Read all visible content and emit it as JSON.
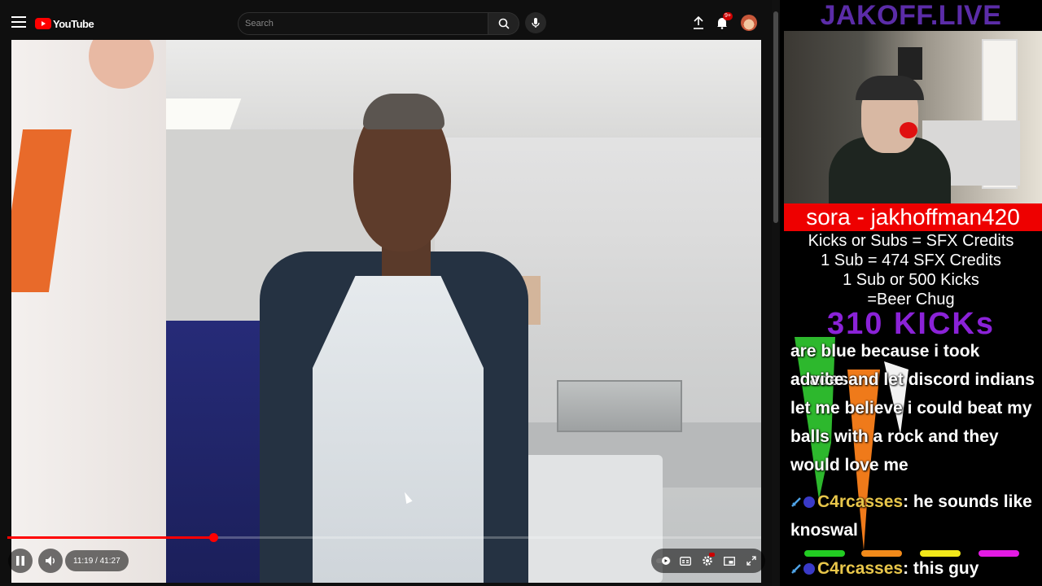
{
  "youtube": {
    "logo_text": "YouTube",
    "search": {
      "placeholder": "Search"
    },
    "notifications_badge": "9+",
    "player": {
      "current_time": "11:19",
      "duration": "41:27",
      "time_display": "11:19 / 41:27",
      "progress_fraction": 0.273,
      "state": "playing"
    }
  },
  "stream_overlay": {
    "channel_title": "JAKOFF.LIVE",
    "now_playing": "sora - jakhoffman420",
    "info_lines": [
      "Kicks or Subs = SFX Credits",
      "1 Sub = 474 SFX Credits",
      "1 Sub or 500 Kicks",
      "=Beer Chug"
    ],
    "kicks_counter": "310 KICKs",
    "chat": {
      "continuation_lines": [
        "are blue because i took acades",
        "advice and let discord indians",
        "let me believe i could beat my",
        "balls with a rock and they",
        "would love me"
      ],
      "messages": [
        {
          "user": "C4rcasses",
          "sep": ":",
          "text": " he sounds like",
          "text_cont": "knoswal"
        },
        {
          "user": "C4rcasses",
          "sep": ":",
          "text": " this guy"
        }
      ]
    },
    "colors": {
      "title": "#5b2ca8",
      "banner": "#ee0000",
      "kicks": "#8b22d8",
      "chat_user": "#e8c64a"
    }
  }
}
